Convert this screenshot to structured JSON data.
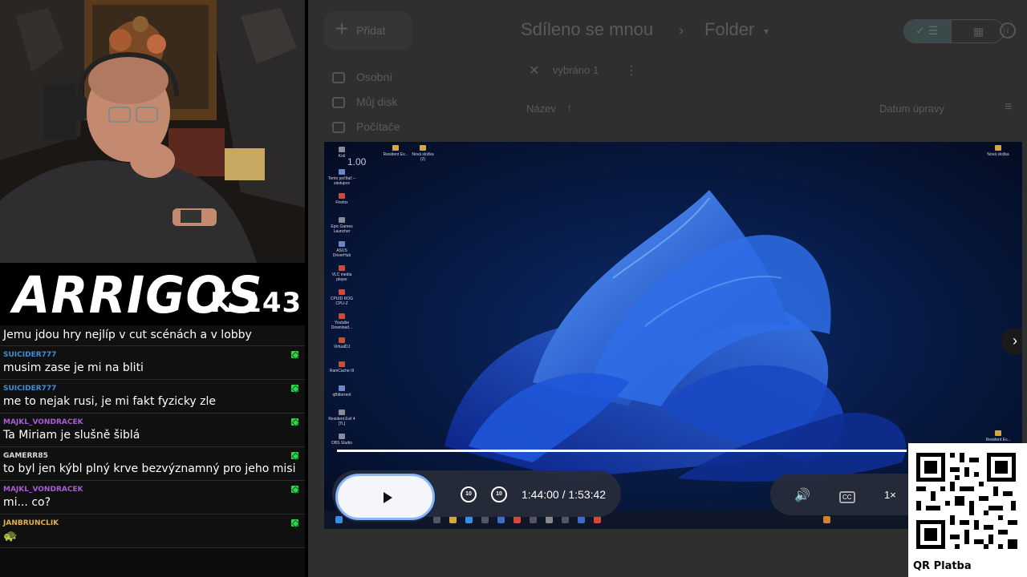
{
  "stream": {
    "channel_logo": "ARRIGOS",
    "counter": "K 143"
  },
  "chat": {
    "pinned_text": "Jemu jdou hry nejlíp v cut scénách a v lobby",
    "messages": [
      {
        "user": "SUICIDER777",
        "text": "musim zase je mi na bliti",
        "color": "#3d8fd8"
      },
      {
        "user": "SUICIDER777",
        "text": "me to nejak rusi, je mi fakt fyzicky zle",
        "color": "#3d8fd8"
      },
      {
        "user": "MAJKL_VONDRACEK",
        "text": "Ta Miriam je slušně šiblá",
        "color": "#a85cd6"
      },
      {
        "user": "GAMERR85",
        "text": "to byl jen kýbl plný krve bezvýznamný pro jeho misi",
        "color": "#d8d8d8"
      },
      {
        "user": "MAJKL_VONDRACEK",
        "text": "mi... co?",
        "color": "#a85cd6"
      },
      {
        "user": "JANBRUNCLIK",
        "text": "🐢",
        "color": "#e0b050"
      }
    ]
  },
  "drive": {
    "add_label": "Přidat",
    "nav": [
      "Osobní",
      "Můj disk",
      "Počítače"
    ],
    "breadcrumb": {
      "root": "Sdíleno se mnou",
      "separator": "›",
      "current": "Folder"
    },
    "selection_label": "vybráno 1",
    "columns": {
      "name": "Název",
      "modified": "Datum úpravy"
    }
  },
  "video": {
    "overlay_version": "1.00",
    "time_display": "1:44:00 / 1:53:42",
    "skip_back_label": "10",
    "skip_forward_label": "10",
    "speed_label": "1×",
    "progress": 0.9147,
    "desktop_icons": [
      "Koš",
      "Resident Ev...",
      "Nová složka (2)",
      "Tento počítač – zástupce",
      "Firefox",
      "Epic Games Launcher",
      "ASUS DriverHub",
      "VLC media player",
      "CPUID ROG CPU-Z",
      "Youtube Download...",
      "VirtualDJ",
      "RamCache III",
      "qBittorrent",
      "Resident Evil 4 [TL]",
      "OBS Studio",
      "Nová složka",
      "Resident Ev..."
    ]
  },
  "qr": {
    "label": "QR Platba"
  },
  "colors": {
    "chat_badge": "#2bd94a",
    "play_ring": "#8ab4f8"
  }
}
